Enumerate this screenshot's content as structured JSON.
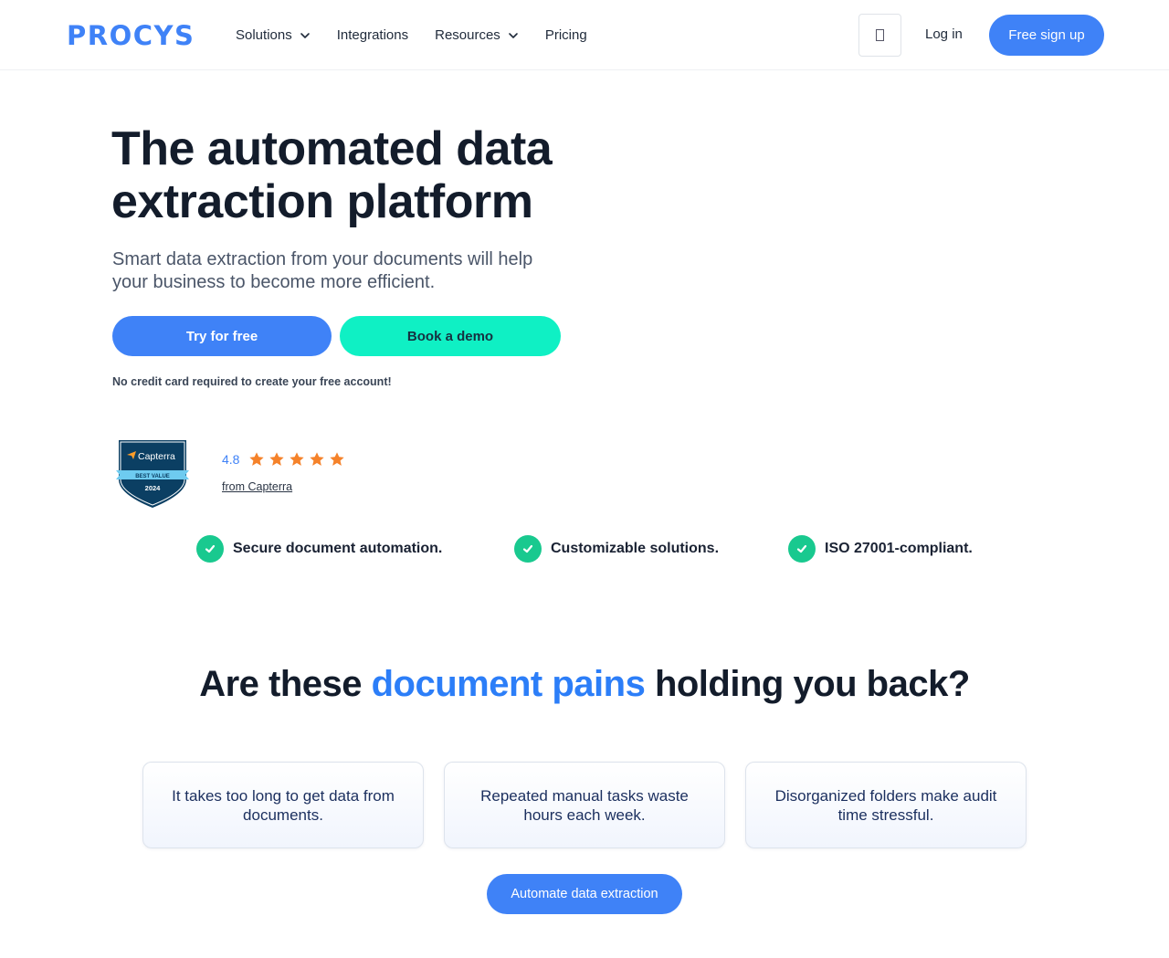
{
  "header": {
    "logo": "PROCYS",
    "nav": [
      {
        "label": "Solutions",
        "dropdown": true
      },
      {
        "label": "Integrations",
        "dropdown": false
      },
      {
        "label": "Resources",
        "dropdown": true
      },
      {
        "label": "Pricing",
        "dropdown": false
      }
    ],
    "icon_button": "device-icon",
    "login_label": "Log in",
    "signup_label": "Free sign up"
  },
  "hero": {
    "title_line1": "The automated data",
    "title_line2": "extraction platform",
    "subtitle_line1": "Smart data extraction from your documents will help",
    "subtitle_line2": "your business to become more efficient.",
    "try_label": "Try for free",
    "demo_label": "Book a demo",
    "note": "No credit card required to create your free account!"
  },
  "capterra": {
    "badge_brand": "Capterra",
    "badge_ribbon": "BEST VALUE",
    "badge_year": "2024",
    "rating": "4.8",
    "stars": 5,
    "source_label": "from Capterra"
  },
  "features": [
    "Secure document automation.",
    "Customizable solutions.",
    "ISO 27001-compliant."
  ],
  "pains": {
    "title_before": "Are these ",
    "title_accent": "document pains",
    "title_after": " holding you back?",
    "cards": [
      "It takes too long to get data from documents.",
      "Repeated manual tasks waste hours each week.",
      "Disorganized folders make audit time stressful."
    ],
    "cta_label": "Automate data extraction"
  },
  "colors": {
    "primary": "#3f82f7",
    "accent_teal": "#0ff0c4",
    "check_green": "#19c98f",
    "star_orange": "#f5822a",
    "text_dark": "#131c2b"
  }
}
